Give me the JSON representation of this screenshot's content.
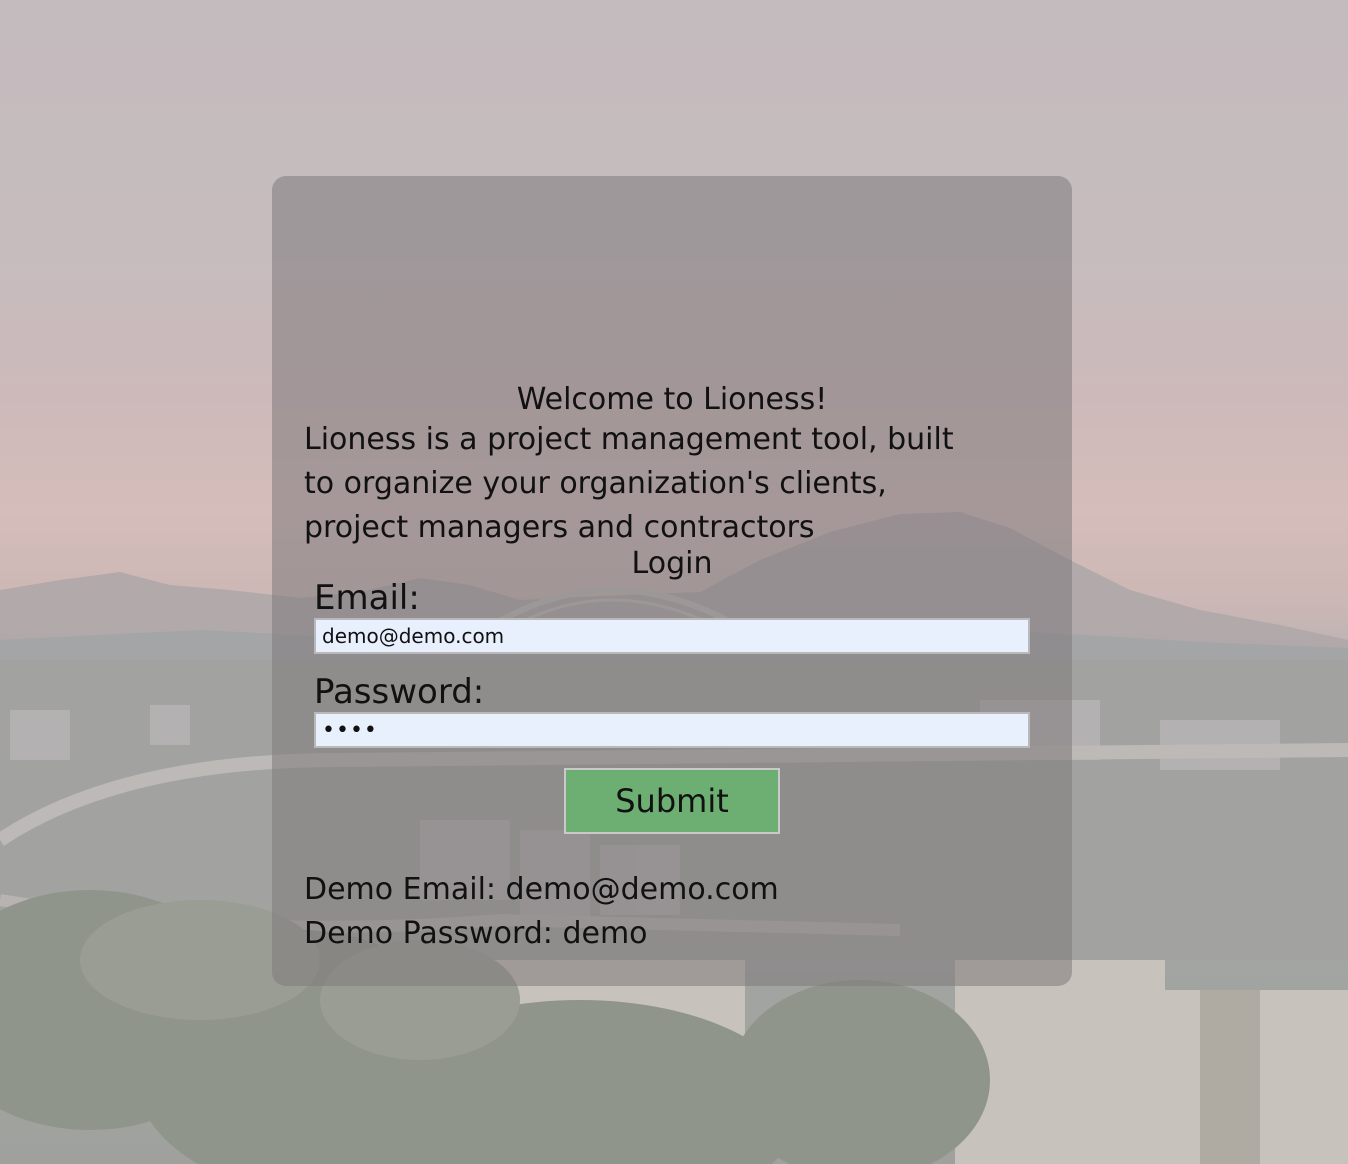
{
  "page": {
    "welcome_heading": "Welcome to Lioness!",
    "intro_text": "Lioness is a project management tool, built to organize your organization's clients, project managers and contractors",
    "login_heading": "Login"
  },
  "form": {
    "email_label": "Email:",
    "email_value": "demo@demo.com",
    "password_label": "Password:",
    "password_value": "demo",
    "submit_label": "Submit"
  },
  "demo_credentials": {
    "email_text": "Demo Email: demo@demo.com",
    "password_text": "Demo Password: demo"
  },
  "colors": {
    "submit_button": "#6daf72",
    "input_background": "#e8f0fd"
  }
}
